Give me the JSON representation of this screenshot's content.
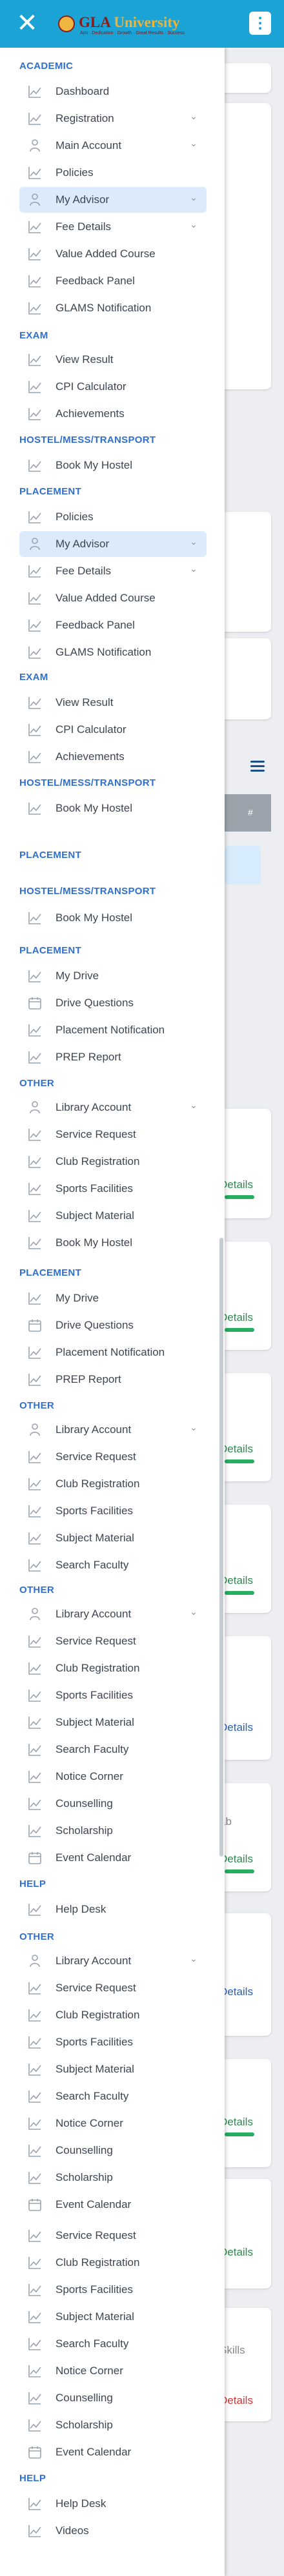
{
  "header": {
    "brand_left": "GLA",
    "brand_right": "University",
    "tagline": "Aim · Dedication · Growth · Great Results · Success",
    "close_icon": "close-icon",
    "menu_icon": "kebab-menu-icon",
    "color": "#1ba3d6"
  },
  "background": {
    "detail_label": "Details",
    "lab_label": "ab",
    "skills_label": "Skills",
    "grid_cell_label": "#"
  },
  "drawer": {
    "rows": [
      {
        "type": "h",
        "label": "ACADEMIC"
      },
      {
        "type": "i",
        "label": "Dashboard",
        "icon": "chart-icon"
      },
      {
        "type": "i",
        "label": "Registration",
        "icon": "chart-icon",
        "chev": true
      },
      {
        "type": "i",
        "label": "Main Account",
        "icon": "person-icon",
        "chev": true
      },
      {
        "type": "i",
        "label": "Policies",
        "icon": "chart-icon"
      },
      {
        "type": "i",
        "label": "My Advisor",
        "icon": "person-icon",
        "chev": true,
        "sel": true
      },
      {
        "type": "i",
        "label": "Fee Details",
        "icon": "chart-icon",
        "chev": true
      },
      {
        "type": "i",
        "label": "Value Added Course",
        "icon": "chart-icon"
      },
      {
        "type": "i",
        "label": "Feedback Panel",
        "icon": "chart-icon"
      },
      {
        "type": "i",
        "label": "GLAMS Notification",
        "icon": "chart-icon"
      },
      {
        "type": "h",
        "label": "EXAM"
      },
      {
        "type": "i",
        "label": "View Result",
        "icon": "chart-icon"
      },
      {
        "type": "i",
        "label": "CPI Calculator",
        "icon": "chart-icon"
      },
      {
        "type": "i",
        "label": "Achievements",
        "icon": "chart-icon"
      },
      {
        "type": "h",
        "label": "HOSTEL/MESS/TRANSPORT"
      },
      {
        "type": "i",
        "label": "Book My Hostel",
        "icon": "chart-icon"
      },
      {
        "type": "h",
        "label": "PLACEMENT"
      },
      {
        "type": "i",
        "label": "Policies",
        "icon": "chart-icon"
      },
      {
        "type": "i",
        "label": "My Advisor",
        "icon": "person-icon",
        "chev": true,
        "sel": true
      },
      {
        "type": "i",
        "label": "Fee Details",
        "icon": "chart-icon",
        "chev": true
      },
      {
        "type": "i",
        "label": "Value Added Course",
        "icon": "chart-icon"
      },
      {
        "type": "i",
        "label": "Feedback Panel",
        "icon": "chart-icon"
      },
      {
        "type": "i",
        "label": "GLAMS Notification",
        "icon": "chart-icon"
      },
      {
        "type": "h",
        "label": "EXAM"
      },
      {
        "type": "i",
        "label": "View Result",
        "icon": "chart-icon"
      },
      {
        "type": "i",
        "label": "CPI Calculator",
        "icon": "chart-icon"
      },
      {
        "type": "i",
        "label": "Achievements",
        "icon": "chart-icon"
      },
      {
        "type": "h",
        "label": "HOSTEL/MESS/TRANSPORT"
      },
      {
        "type": "i",
        "label": "Book My Hostel",
        "icon": "chart-icon"
      },
      {
        "type": "h",
        "label": "PLACEMENT"
      },
      {
        "type": "h",
        "label": "HOSTEL/MESS/TRANSPORT"
      },
      {
        "type": "i",
        "label": "Book My Hostel",
        "icon": "chart-icon"
      },
      {
        "type": "h",
        "label": "PLACEMENT"
      },
      {
        "type": "i",
        "label": "My Drive",
        "icon": "chart-icon"
      },
      {
        "type": "i",
        "label": "Drive Questions",
        "icon": "calendar-icon"
      },
      {
        "type": "i",
        "label": "Placement Notification",
        "icon": "chart-icon"
      },
      {
        "type": "i",
        "label": "PREP Report",
        "icon": "chart-icon"
      },
      {
        "type": "h",
        "label": "OTHER"
      },
      {
        "type": "i",
        "label": "Library Account",
        "icon": "person-icon",
        "chev": true
      },
      {
        "type": "i",
        "label": "Service Request",
        "icon": "chart-icon"
      },
      {
        "type": "i",
        "label": "Club Registration",
        "icon": "chart-icon"
      },
      {
        "type": "i",
        "label": "Sports Facilities",
        "icon": "chart-icon"
      },
      {
        "type": "i",
        "label": "Subject Material",
        "icon": "chart-icon"
      },
      {
        "type": "i",
        "label": "Book My Hostel",
        "icon": "chart-icon"
      },
      {
        "type": "h",
        "label": "PLACEMENT"
      },
      {
        "type": "i",
        "label": "My Drive",
        "icon": "chart-icon"
      },
      {
        "type": "i",
        "label": "Drive Questions",
        "icon": "calendar-icon"
      },
      {
        "type": "i",
        "label": "Placement Notification",
        "icon": "chart-icon"
      },
      {
        "type": "i",
        "label": "PREP Report",
        "icon": "chart-icon"
      },
      {
        "type": "h",
        "label": "OTHER"
      },
      {
        "type": "i",
        "label": "Library Account",
        "icon": "person-icon",
        "chev": true
      },
      {
        "type": "i",
        "label": "Service Request",
        "icon": "chart-icon"
      },
      {
        "type": "i",
        "label": "Club Registration",
        "icon": "chart-icon"
      },
      {
        "type": "i",
        "label": "Sports Facilities",
        "icon": "chart-icon"
      },
      {
        "type": "i",
        "label": "Subject Material",
        "icon": "chart-icon"
      },
      {
        "type": "i",
        "label": "Search Faculty",
        "icon": "chart-icon"
      },
      {
        "type": "h",
        "label": "OTHER"
      },
      {
        "type": "i",
        "label": "Library Account",
        "icon": "person-icon",
        "chev": true
      },
      {
        "type": "i",
        "label": "Service Request",
        "icon": "chart-icon"
      },
      {
        "type": "i",
        "label": "Club Registration",
        "icon": "chart-icon"
      },
      {
        "type": "i",
        "label": "Sports Facilities",
        "icon": "chart-icon"
      },
      {
        "type": "i",
        "label": "Subject Material",
        "icon": "chart-icon"
      },
      {
        "type": "i",
        "label": "Search Faculty",
        "icon": "chart-icon"
      },
      {
        "type": "i",
        "label": "Notice Corner",
        "icon": "chart-icon"
      },
      {
        "type": "i",
        "label": "Counselling",
        "icon": "chart-icon"
      },
      {
        "type": "i",
        "label": "Scholarship",
        "icon": "chart-icon"
      },
      {
        "type": "i",
        "label": "Event Calendar",
        "icon": "calendar-icon"
      },
      {
        "type": "h",
        "label": "HELP"
      },
      {
        "type": "i",
        "label": "Help Desk",
        "icon": "chart-icon"
      },
      {
        "type": "h",
        "label": "OTHER"
      },
      {
        "type": "i",
        "label": "Library Account",
        "icon": "person-icon",
        "chev": true
      },
      {
        "type": "i",
        "label": "Service Request",
        "icon": "chart-icon"
      },
      {
        "type": "i",
        "label": "Club Registration",
        "icon": "chart-icon"
      },
      {
        "type": "i",
        "label": "Sports Facilities",
        "icon": "chart-icon"
      },
      {
        "type": "i",
        "label": "Subject Material",
        "icon": "chart-icon"
      },
      {
        "type": "i",
        "label": "Search Faculty",
        "icon": "chart-icon"
      },
      {
        "type": "i",
        "label": "Notice Corner",
        "icon": "chart-icon"
      },
      {
        "type": "i",
        "label": "Counselling",
        "icon": "chart-icon"
      },
      {
        "type": "i",
        "label": "Scholarship",
        "icon": "chart-icon"
      },
      {
        "type": "i",
        "label": "Event Calendar",
        "icon": "calendar-icon"
      },
      {
        "type": "i",
        "label": "Service Request",
        "icon": "chart-icon"
      },
      {
        "type": "i",
        "label": "Club Registration",
        "icon": "chart-icon"
      },
      {
        "type": "i",
        "label": "Sports Facilities",
        "icon": "chart-icon"
      },
      {
        "type": "i",
        "label": "Subject Material",
        "icon": "chart-icon"
      },
      {
        "type": "i",
        "label": "Search Faculty",
        "icon": "chart-icon"
      },
      {
        "type": "i",
        "label": "Notice Corner",
        "icon": "chart-icon"
      },
      {
        "type": "i",
        "label": "Counselling",
        "icon": "chart-icon"
      },
      {
        "type": "i",
        "label": "Scholarship",
        "icon": "chart-icon"
      },
      {
        "type": "i",
        "label": "Event Calendar",
        "icon": "calendar-icon"
      },
      {
        "type": "h",
        "label": "HELP"
      },
      {
        "type": "i",
        "label": "Help Desk",
        "icon": "chart-icon"
      },
      {
        "type": "i",
        "label": "Videos",
        "icon": "chart-icon"
      }
    ]
  },
  "colors": {
    "section_header": "#2f6fce",
    "selected_bg": "#dcebfb",
    "item_text": "#3d4651"
  }
}
